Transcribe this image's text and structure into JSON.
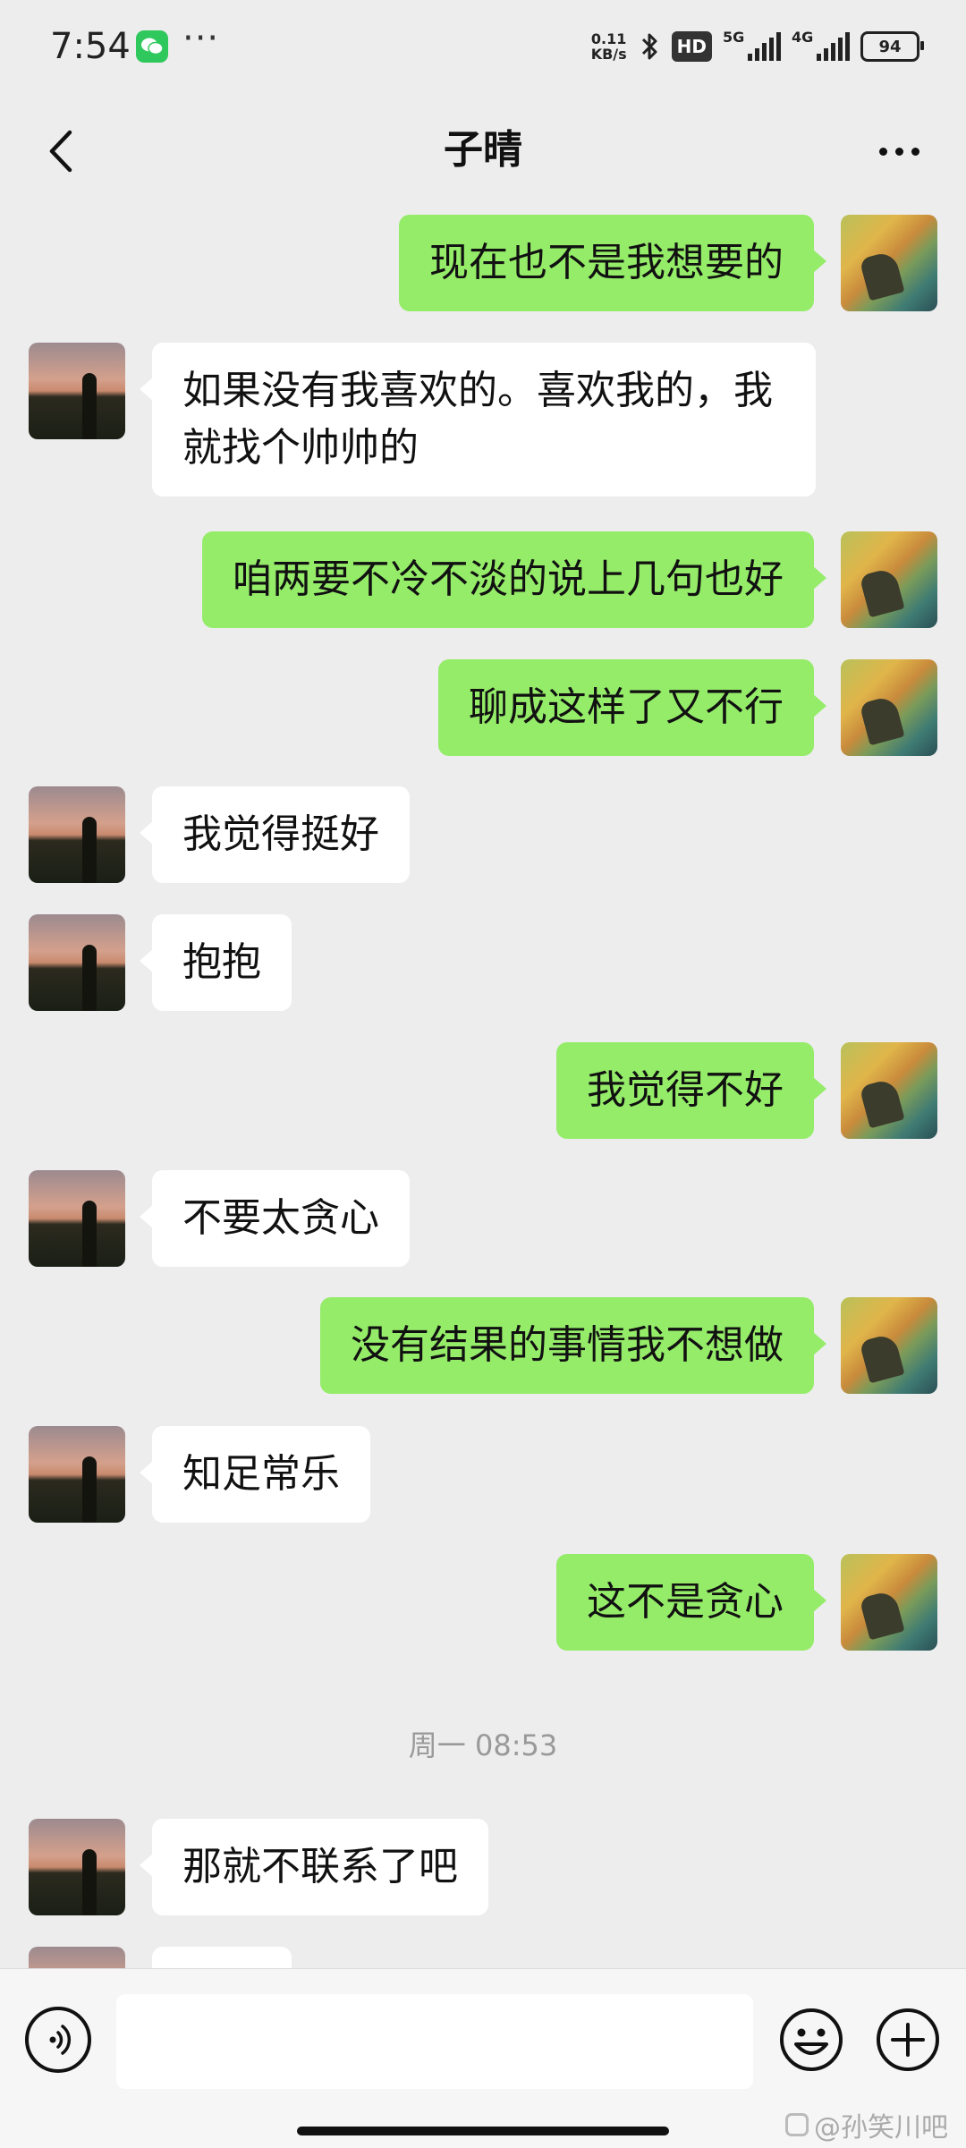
{
  "status_bar": {
    "time": "7:54",
    "more": "···",
    "net_speed_value": "0.11",
    "net_speed_unit": "KB/s",
    "hd_label": "HD",
    "signal_1_label": "5G",
    "signal_2_label": "4G",
    "battery": "94"
  },
  "header": {
    "title": "子晴"
  },
  "messages": [
    {
      "side": "out",
      "text": "现在也不是我想要的"
    },
    {
      "side": "in",
      "text": "如果没有我喜欢的。喜欢我的，我就找个帅帅的"
    },
    {
      "side": "out",
      "text": "咱两要不冷不淡的说上几句也好"
    },
    {
      "side": "out",
      "text": "聊成这样了又不行"
    },
    {
      "side": "in",
      "text": "我觉得挺好"
    },
    {
      "side": "in",
      "text": "抱抱"
    },
    {
      "side": "out",
      "text": "我觉得不好"
    },
    {
      "side": "in",
      "text": "不要太贪心"
    },
    {
      "side": "out",
      "text": "没有结果的事情我不想做"
    },
    {
      "side": "in",
      "text": "知足常乐"
    },
    {
      "side": "out",
      "text": "这不是贪心"
    },
    {
      "side": "in",
      "text": "那就不联系了吧"
    }
  ],
  "timestamp": "周一 08:53",
  "input": {
    "value": ""
  },
  "watermark": "@孙笑川吧",
  "colors": {
    "background": "#ededed",
    "outgoing_bubble": "#95ec69",
    "incoming_bubble": "#ffffff"
  }
}
